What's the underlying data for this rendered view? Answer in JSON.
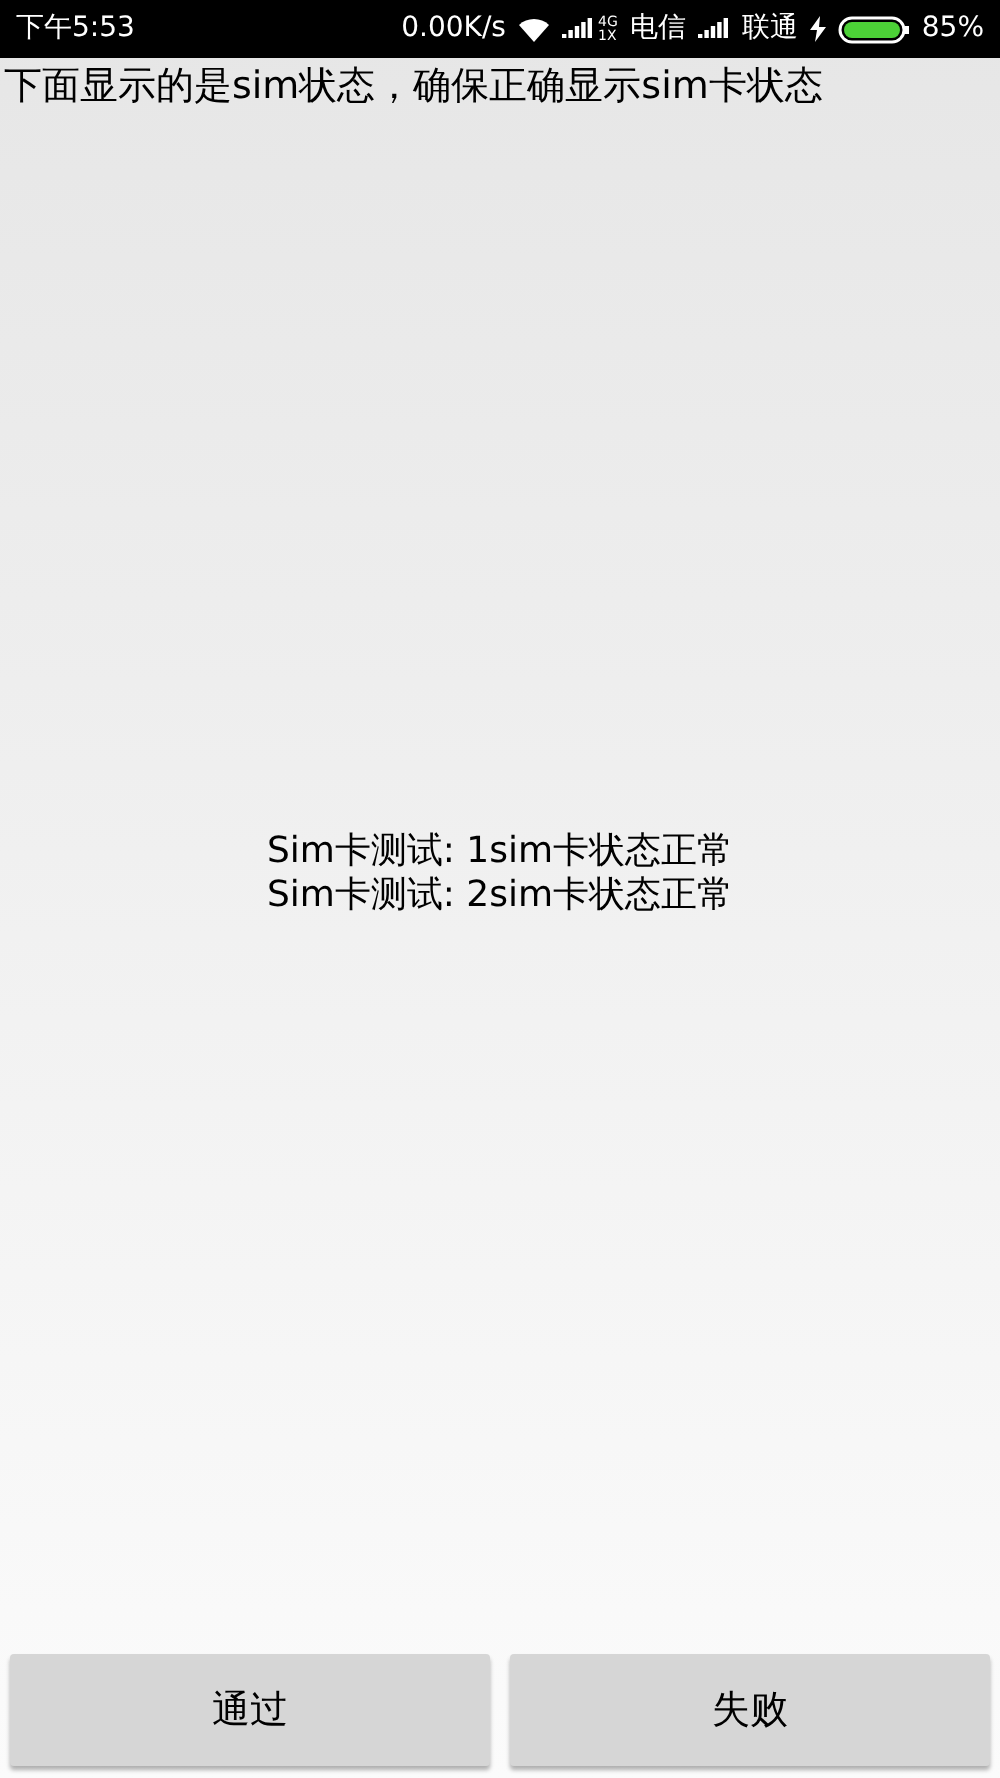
{
  "status_bar": {
    "time": "下午5:53",
    "speed": "0.00K/s",
    "network_badge_top": "4G",
    "network_badge_bottom": "1X",
    "carrier_1": "电信",
    "carrier_2": "联通",
    "charging": true,
    "battery": "85%"
  },
  "instruction": "下面显示的是sim状态，确保正确显示sim卡状态",
  "results": [
    "Sim卡测试: 1sim卡状态正常",
    "Sim卡测试: 2sim卡状态正常"
  ],
  "buttons": [
    "通过",
    "失败"
  ]
}
